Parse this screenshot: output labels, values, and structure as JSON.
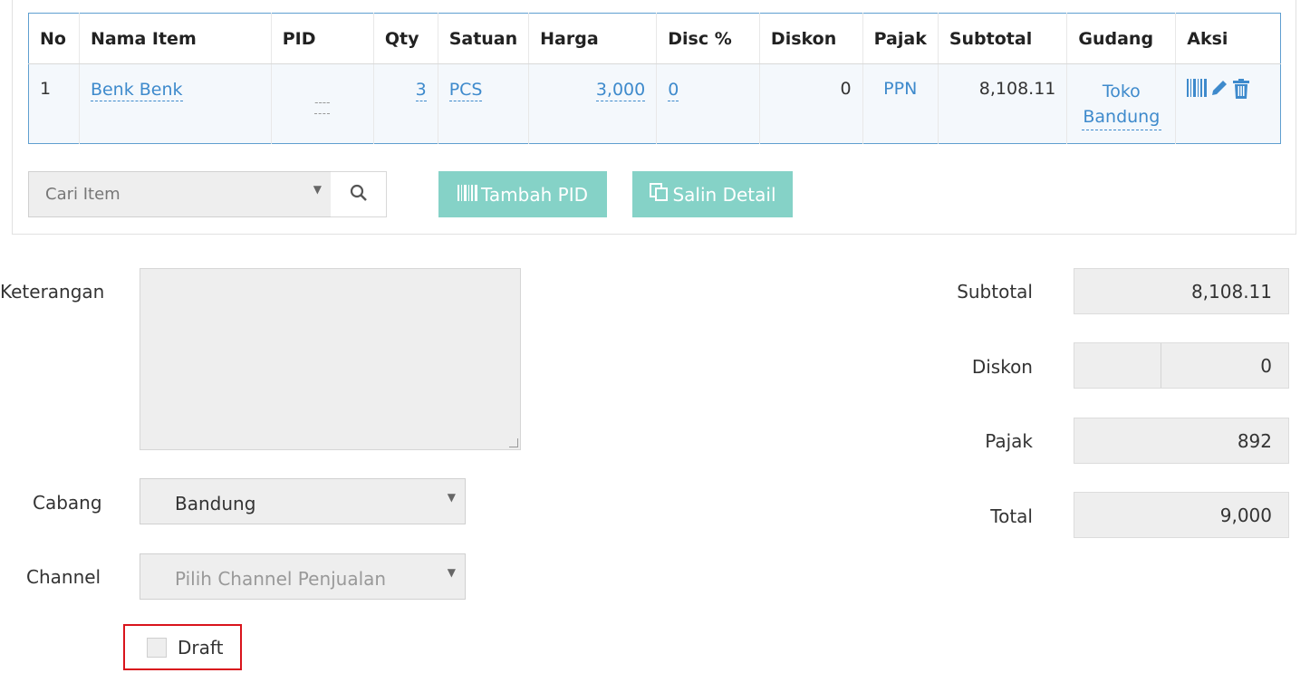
{
  "table": {
    "headers": [
      "No",
      "Nama Item",
      "PID",
      "Qty",
      "Satuan",
      "Harga",
      "Disc %",
      "Diskon",
      "Pajak",
      "Subtotal",
      "Gudang",
      "Aksi"
    ],
    "rows": [
      {
        "no": "1",
        "nama_item": "Benk Benk",
        "pid": "----",
        "qty": "3",
        "satuan": "PCS",
        "harga": "3,000",
        "disc_pct": "0",
        "diskon": "0",
        "pajak": "PPN",
        "subtotal": "8,108.11",
        "gudang": "Toko Bandung",
        "aksi_icons": [
          "barcode-icon",
          "pencil-icon",
          "trash-icon"
        ]
      }
    ]
  },
  "item_search": {
    "placeholder": "Cari Item",
    "icon": "search-icon"
  },
  "buttons": {
    "tambah_pid": {
      "label": "Tambah PID",
      "icon": "barcode-icon"
    },
    "salin_detail": {
      "label": "Salin Detail",
      "icon": "copy-icon"
    }
  },
  "form": {
    "keterangan_label": "Keterangan",
    "keterangan_value": "",
    "cabang_label": "Cabang",
    "cabang_value": "Bandung",
    "channel_label": "Channel",
    "channel_placeholder": "Pilih Channel Penjualan",
    "draft_label": "Draft"
  },
  "summary": {
    "subtotal_label": "Subtotal",
    "subtotal_value": "8,108.11",
    "diskon_label": "Diskon",
    "diskon_value": "0",
    "pajak_label": "Pajak",
    "pajak_value": "892",
    "total_label": "Total",
    "total_value": "9,000"
  },
  "colors": {
    "link_blue": "#3e8acc",
    "table_border": "#5f9fd0",
    "teal_button": "#85d2c7",
    "highlight_red": "#d9141c",
    "field_gray": "#eeeeee"
  }
}
